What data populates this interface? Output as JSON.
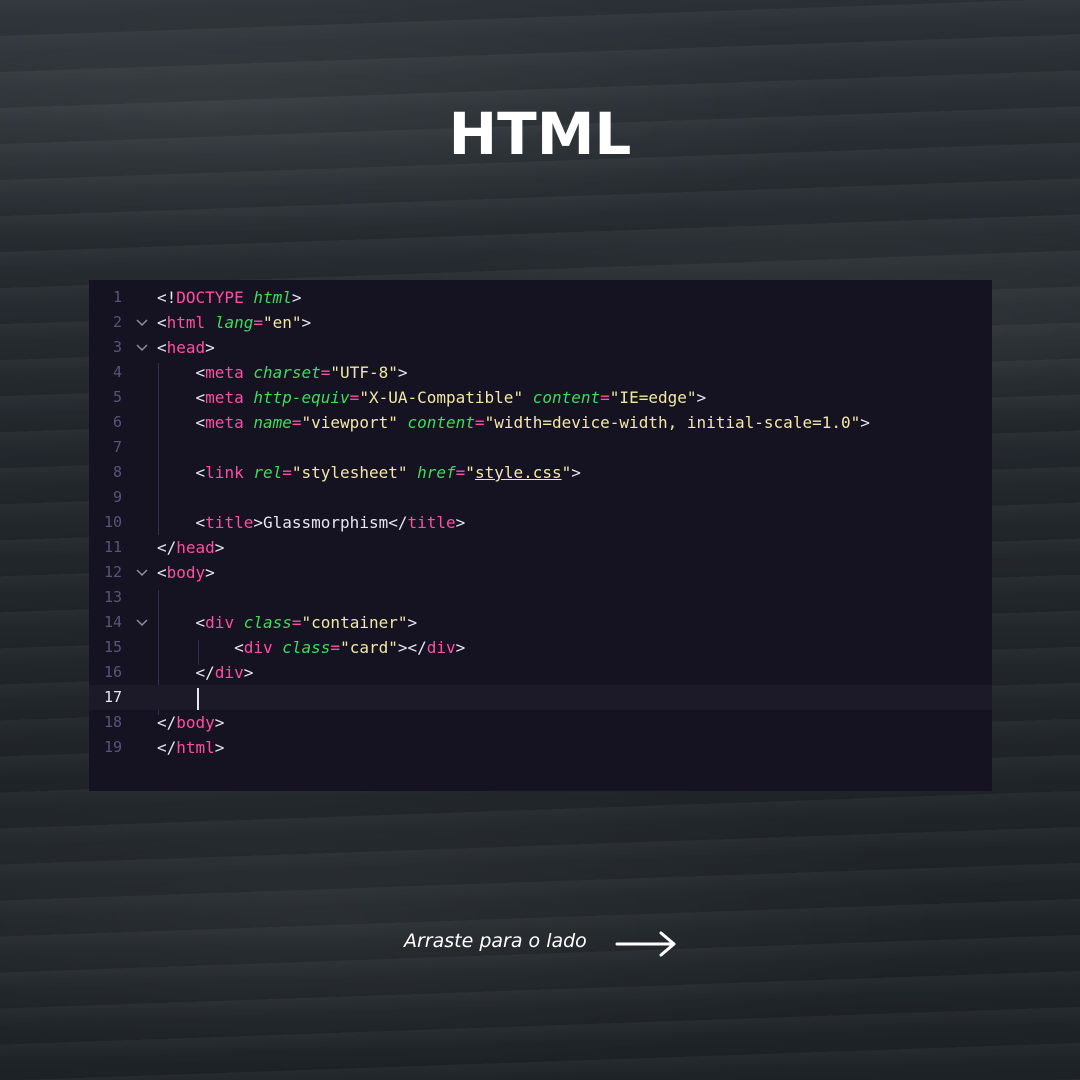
{
  "title": "HTML",
  "editor": {
    "active_line": 17,
    "lines": [
      {
        "n": "1",
        "fold": false,
        "tokens": [
          [
            "punc",
            "<!"
          ],
          [
            "tag",
            "DOCTYPE"
          ],
          [
            "punc",
            " "
          ],
          [
            "attr",
            "html"
          ],
          [
            "punc",
            ">"
          ]
        ]
      },
      {
        "n": "2",
        "fold": true,
        "tokens": [
          [
            "punc",
            "<"
          ],
          [
            "tag",
            "html"
          ],
          [
            "punc",
            " "
          ],
          [
            "attr",
            "lang"
          ],
          [
            "eq",
            "="
          ],
          [
            "str",
            "\"en\""
          ],
          [
            "punc",
            ">"
          ]
        ]
      },
      {
        "n": "3",
        "fold": true,
        "tokens": [
          [
            "punc",
            "<"
          ],
          [
            "tag",
            "head"
          ],
          [
            "punc",
            ">"
          ]
        ]
      },
      {
        "n": "4",
        "fold": false,
        "tokens": [
          [
            "punc",
            "    <"
          ],
          [
            "tag",
            "meta"
          ],
          [
            "punc",
            " "
          ],
          [
            "attr",
            "charset"
          ],
          [
            "eq",
            "="
          ],
          [
            "str",
            "\"UTF-8\""
          ],
          [
            "punc",
            ">"
          ]
        ]
      },
      {
        "n": "5",
        "fold": false,
        "tokens": [
          [
            "punc",
            "    <"
          ],
          [
            "tag",
            "meta"
          ],
          [
            "punc",
            " "
          ],
          [
            "attr",
            "http-equiv"
          ],
          [
            "eq",
            "="
          ],
          [
            "str",
            "\"X-UA-Compatible\""
          ],
          [
            "punc",
            " "
          ],
          [
            "attr",
            "content"
          ],
          [
            "eq",
            "="
          ],
          [
            "str",
            "\"IE=edge\""
          ],
          [
            "punc",
            ">"
          ]
        ]
      },
      {
        "n": "6",
        "fold": false,
        "tokens": [
          [
            "punc",
            "    <"
          ],
          [
            "tag",
            "meta"
          ],
          [
            "punc",
            " "
          ],
          [
            "attr",
            "name"
          ],
          [
            "eq",
            "="
          ],
          [
            "str",
            "\"viewport\""
          ],
          [
            "punc",
            " "
          ],
          [
            "attr",
            "content"
          ],
          [
            "eq",
            "="
          ],
          [
            "str",
            "\"width=device-width, initial-scale=1.0\""
          ],
          [
            "punc",
            ">"
          ]
        ]
      },
      {
        "n": "7",
        "fold": false,
        "tokens": []
      },
      {
        "n": "8",
        "fold": false,
        "tokens": [
          [
            "punc",
            "    <"
          ],
          [
            "tag",
            "link"
          ],
          [
            "punc",
            " "
          ],
          [
            "attr",
            "rel"
          ],
          [
            "eq",
            "="
          ],
          [
            "str",
            "\"stylesheet\""
          ],
          [
            "punc",
            " "
          ],
          [
            "attr",
            "href"
          ],
          [
            "eq",
            "="
          ],
          [
            "str",
            "\""
          ],
          [
            "link",
            "style.css"
          ],
          [
            "str",
            "\""
          ],
          [
            "punc",
            ">"
          ]
        ]
      },
      {
        "n": "9",
        "fold": false,
        "tokens": []
      },
      {
        "n": "10",
        "fold": false,
        "tokens": [
          [
            "punc",
            "    <"
          ],
          [
            "tag",
            "title"
          ],
          [
            "punc",
            ">"
          ],
          [
            "text",
            "Glassmorphism"
          ],
          [
            "punc",
            "</"
          ],
          [
            "tag",
            "title"
          ],
          [
            "punc",
            ">"
          ]
        ]
      },
      {
        "n": "11",
        "fold": false,
        "tokens": [
          [
            "punc",
            "</"
          ],
          [
            "tag",
            "head"
          ],
          [
            "punc",
            ">"
          ]
        ]
      },
      {
        "n": "12",
        "fold": true,
        "tokens": [
          [
            "punc",
            "<"
          ],
          [
            "tag",
            "body"
          ],
          [
            "punc",
            ">"
          ]
        ]
      },
      {
        "n": "13",
        "fold": false,
        "tokens": []
      },
      {
        "n": "14",
        "fold": true,
        "tokens": [
          [
            "punc",
            "    <"
          ],
          [
            "tag",
            "div"
          ],
          [
            "punc",
            " "
          ],
          [
            "attr",
            "class"
          ],
          [
            "eq",
            "="
          ],
          [
            "str",
            "\"container\""
          ],
          [
            "punc",
            ">"
          ]
        ]
      },
      {
        "n": "15",
        "fold": false,
        "tokens": [
          [
            "punc",
            "        <"
          ],
          [
            "tag",
            "div"
          ],
          [
            "punc",
            " "
          ],
          [
            "attr",
            "class"
          ],
          [
            "eq",
            "="
          ],
          [
            "str",
            "\"card\""
          ],
          [
            "punc",
            "></"
          ],
          [
            "tag",
            "div"
          ],
          [
            "punc",
            ">"
          ]
        ]
      },
      {
        "n": "16",
        "fold": false,
        "tokens": [
          [
            "punc",
            "    </"
          ],
          [
            "tag",
            "div"
          ],
          [
            "punc",
            ">"
          ]
        ]
      },
      {
        "n": "17",
        "fold": false,
        "tokens": []
      },
      {
        "n": "18",
        "fold": false,
        "tokens": [
          [
            "punc",
            "</"
          ],
          [
            "tag",
            "body"
          ],
          [
            "punc",
            ">"
          ]
        ]
      },
      {
        "n": "19",
        "fold": false,
        "tokens": [
          [
            "punc",
            "</"
          ],
          [
            "tag",
            "html"
          ],
          [
            "punc",
            ">"
          ]
        ]
      }
    ]
  },
  "swipe": {
    "label": "Arraste para o lado",
    "icon": "arrow-right-icon"
  }
}
